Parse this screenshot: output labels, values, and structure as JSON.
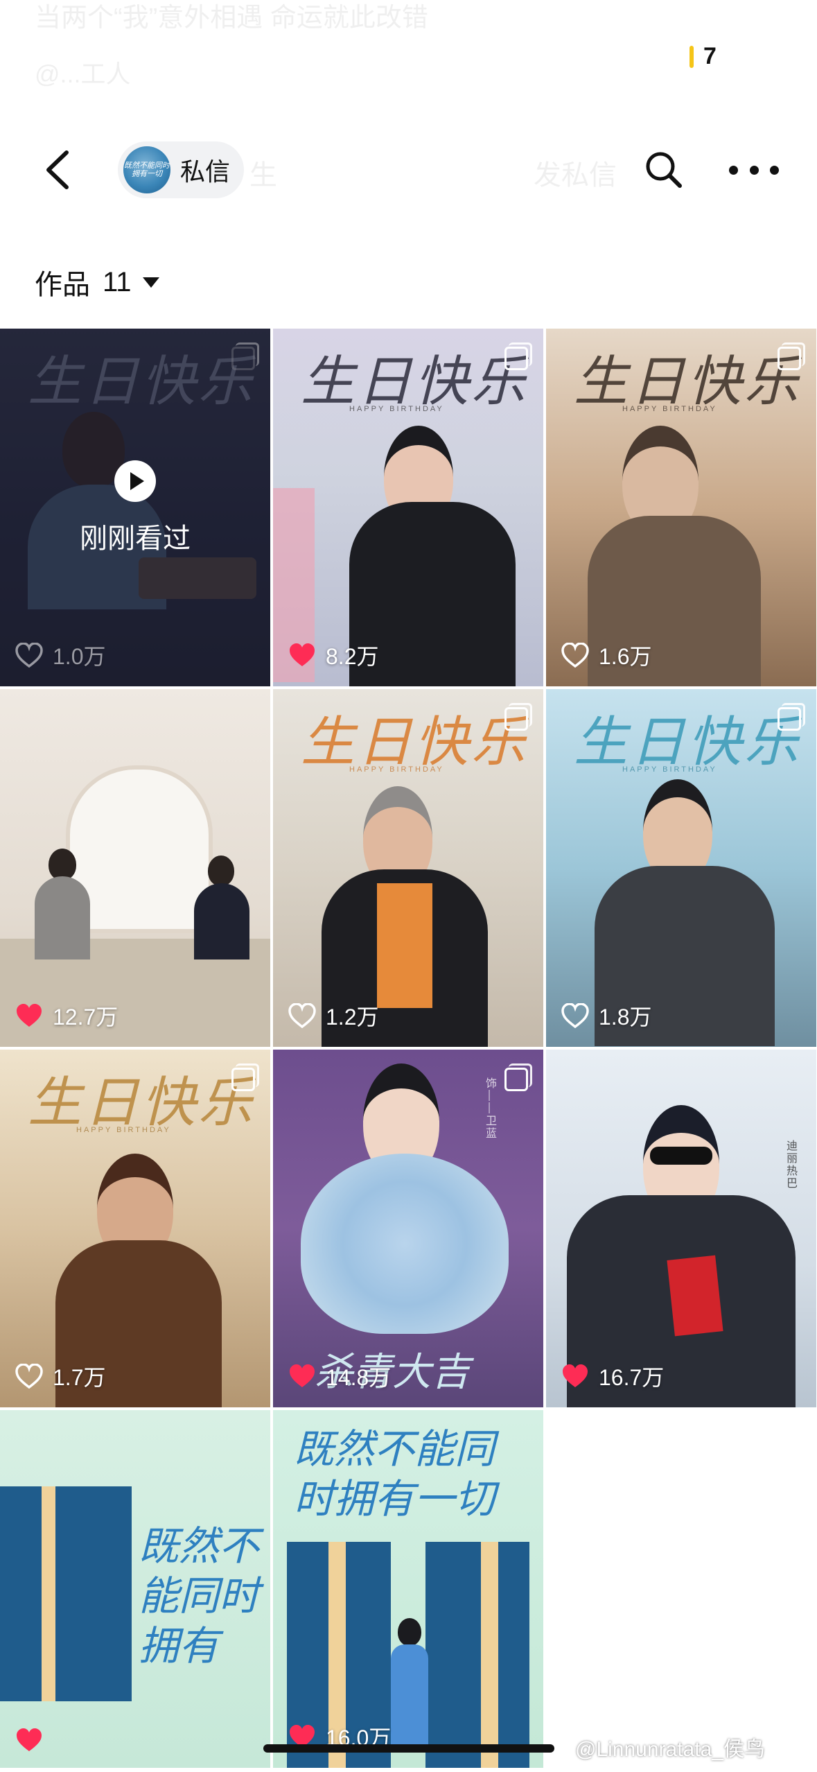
{
  "status": {
    "banner_text": "当两个“我”意外相遇 命运就此改错",
    "banner_sub": "@...工人",
    "notification_count": "7"
  },
  "nav": {
    "dm_label": "私信",
    "avatar_text": "既然不能同时拥有一切",
    "faint_follow": "生",
    "faint_send": "发私信"
  },
  "works": {
    "label": "作品",
    "count": "11"
  },
  "tiles": [
    {
      "likes": "1.0万",
      "liked": false,
      "seen_label": "刚刚看过"
    },
    {
      "likes": "8.2万",
      "liked": true,
      "title": "生日快乐",
      "subtitle": "HAPPY BIRTHDAY"
    },
    {
      "likes": "1.6万",
      "liked": false,
      "title": "生日快乐",
      "subtitle": "HAPPY BIRTHDAY"
    },
    {
      "likes": "12.7万",
      "liked": true
    },
    {
      "likes": "1.2万",
      "liked": false,
      "title": "生日快乐",
      "subtitle": "HAPPY BIRTHDAY"
    },
    {
      "likes": "1.8万",
      "liked": false,
      "title": "生日快乐",
      "subtitle": "HAPPY BIRTHDAY"
    },
    {
      "likes": "1.7万",
      "liked": false,
      "title": "生日快乐",
      "subtitle": "HAPPY BIRTHDAY"
    },
    {
      "likes": "14.8万",
      "liked": true,
      "caption": "杀青大吉",
      "credit": "饰——卫蓝"
    },
    {
      "likes": "16.7万",
      "liked": true,
      "credit": "迪丽热巴"
    },
    {
      "likes": "",
      "liked": true,
      "poster_text": "既然不能同时拥有"
    },
    {
      "likes": "16.0万",
      "liked": true,
      "poster_text": "既然不能同时拥有一切"
    }
  ],
  "watermark": "@Linnunratata_侯鸟",
  "colors": {
    "like_red": "#fe2c55",
    "notif_yellow": "#f5c518",
    "avatar_blue": "#3b86b8"
  },
  "icons": [
    "back-arrow-icon",
    "search-icon",
    "more-icon",
    "heart-icon",
    "play-icon",
    "multi-image-icon",
    "caret-down-icon"
  ]
}
